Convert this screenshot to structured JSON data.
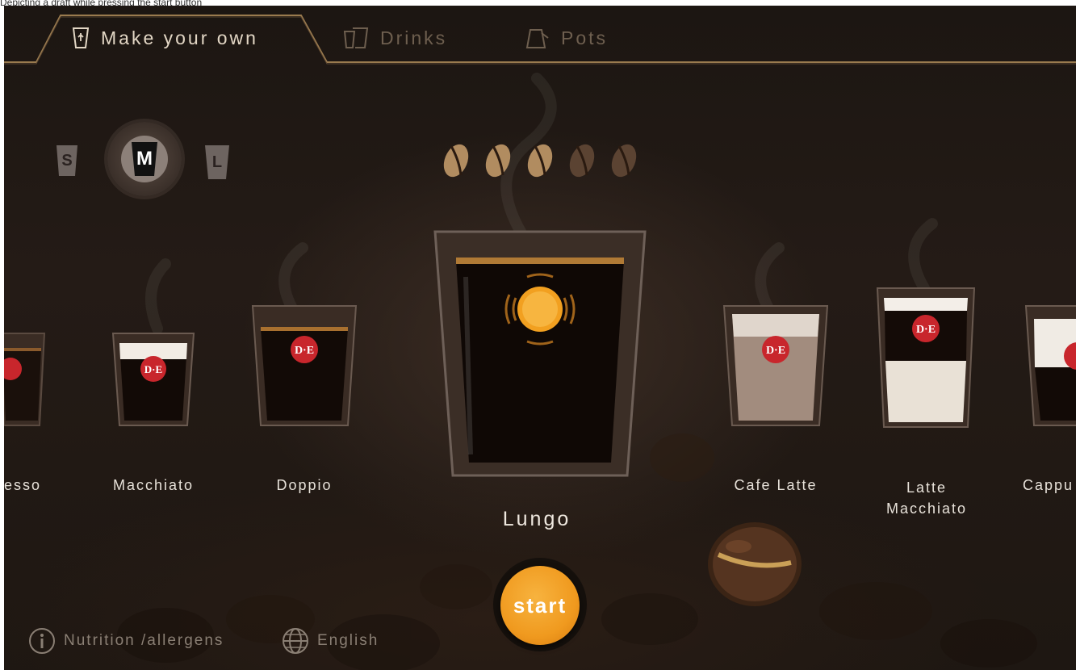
{
  "caption": "Depicting a draft while pressing the start button",
  "tabs": [
    {
      "label": "Make your own",
      "icon": "cup-icon",
      "active": true
    },
    {
      "label": "Drinks",
      "icon": "glasses-icon",
      "active": false
    },
    {
      "label": "Pots",
      "icon": "pot-icon",
      "active": false
    }
  ],
  "sizes": {
    "small": "S",
    "medium": "M",
    "large": "L",
    "selected": "M"
  },
  "strength": {
    "level": 3,
    "max": 5
  },
  "drinks": [
    {
      "label": "esso"
    },
    {
      "label": "Macchiato"
    },
    {
      "label": "Doppio"
    },
    {
      "label": "Lungo",
      "selected": true
    },
    {
      "label": "Cafe Latte"
    },
    {
      "label": "Latte Macchiato"
    },
    {
      "label": "Cappu"
    }
  ],
  "cup_logo": "D·E",
  "start_label": "start",
  "footer": {
    "nutrition": "Nutrition /allergens",
    "language": "English"
  },
  "colors": {
    "accent": "#f09a1f",
    "gold": "#a8875a",
    "logo_red": "#c8262c"
  }
}
